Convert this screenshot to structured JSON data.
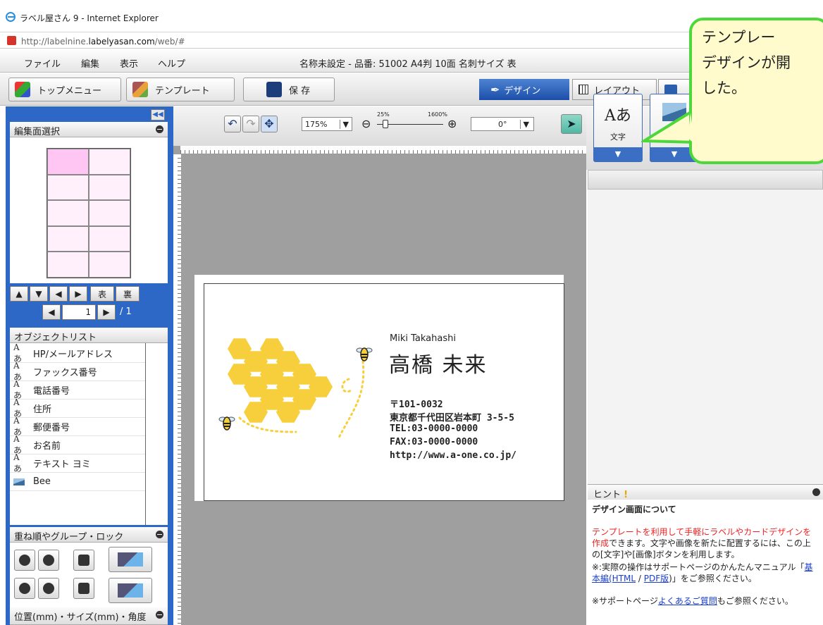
{
  "window": {
    "title": "ラベル屋さん 9 - Internet Explorer"
  },
  "address": {
    "prefix": "http://labelnine.",
    "domain": "labelyasan.com",
    "suffix": "/web/#"
  },
  "menu": {
    "items": [
      "ファイル",
      "編集",
      "表示",
      "ヘルプ"
    ],
    "doc_title": "名称未設定 - 品番: 51002 A4判 10面 名刺サイズ 表"
  },
  "toolbar": {
    "top_menu": "トップメニュー",
    "template": "テンプレート",
    "save": "保 存"
  },
  "modes": {
    "design": "デザイン",
    "layout": "レイアウト"
  },
  "face_select": {
    "title": "編集面選択",
    "front": "表",
    "back": "裏",
    "page_value": "1",
    "page_total": "/ 1"
  },
  "zoom": {
    "value": "175%",
    "min_label": "25%",
    "max_label": "1600%",
    "angle": "0°"
  },
  "objects": {
    "title": "オブジェクトリスト",
    "items": [
      {
        "icon": "text-icon",
        "label": "HP/メールアドレス"
      },
      {
        "icon": "text-icon",
        "label": "ファックス番号"
      },
      {
        "icon": "text-icon",
        "label": "電話番号"
      },
      {
        "icon": "text-icon",
        "label": "住所"
      },
      {
        "icon": "text-icon",
        "label": "郵便番号"
      },
      {
        "icon": "text-icon",
        "label": "お名前"
      },
      {
        "icon": "text-icon",
        "label": "テキスト ヨミ"
      },
      {
        "icon": "image-icon",
        "label": "Bee"
      }
    ]
  },
  "order_panel": {
    "title": "重ね順やグループ・ロック"
  },
  "position_panel": {
    "title": "位置(mm)・サイズ(mm)・角度"
  },
  "card": {
    "roman_name": "Miki Takahashi",
    "name": "高橋 未来",
    "postal": "〒101-0032",
    "address": "東京都千代田区岩本町 3-5-5",
    "tel": "TEL:03-0000-0000",
    "fax": "FAX:03-0000-0000",
    "url": "http://www.a-one.co.jp/",
    "honey_color": "#f7cf3c"
  },
  "insert_buttons": {
    "text_label": "文字",
    "text_glyph": "Aあ",
    "image_label": "画像"
  },
  "hint": {
    "title": "ヒント",
    "heading": "デザイン画面について",
    "p1_red": "テンプレートを利用して手軽にラベルやカードデザインを作成",
    "p1_rest": "できます。文字や画像を新たに配置するには、この上の[文字]や[画像]ボタンを利用します。",
    "p2_pre": "※:実際の操作はサポートページのかんたんマニュアル「",
    "p2_link1": "基本編(HTML",
    "p2_sep": " / ",
    "p2_link2": "PDF版",
    "p2_post": ")」をご参照ください。",
    "p3_pre": "※サポートページ",
    "p3_link": "よくあるご質問",
    "p3_post": "もご参照ください。"
  },
  "callout": {
    "text": "テンプレー\nデザインが開\nした。",
    "border_color": "#4cd83a",
    "fill_color": "#fffbcc"
  }
}
